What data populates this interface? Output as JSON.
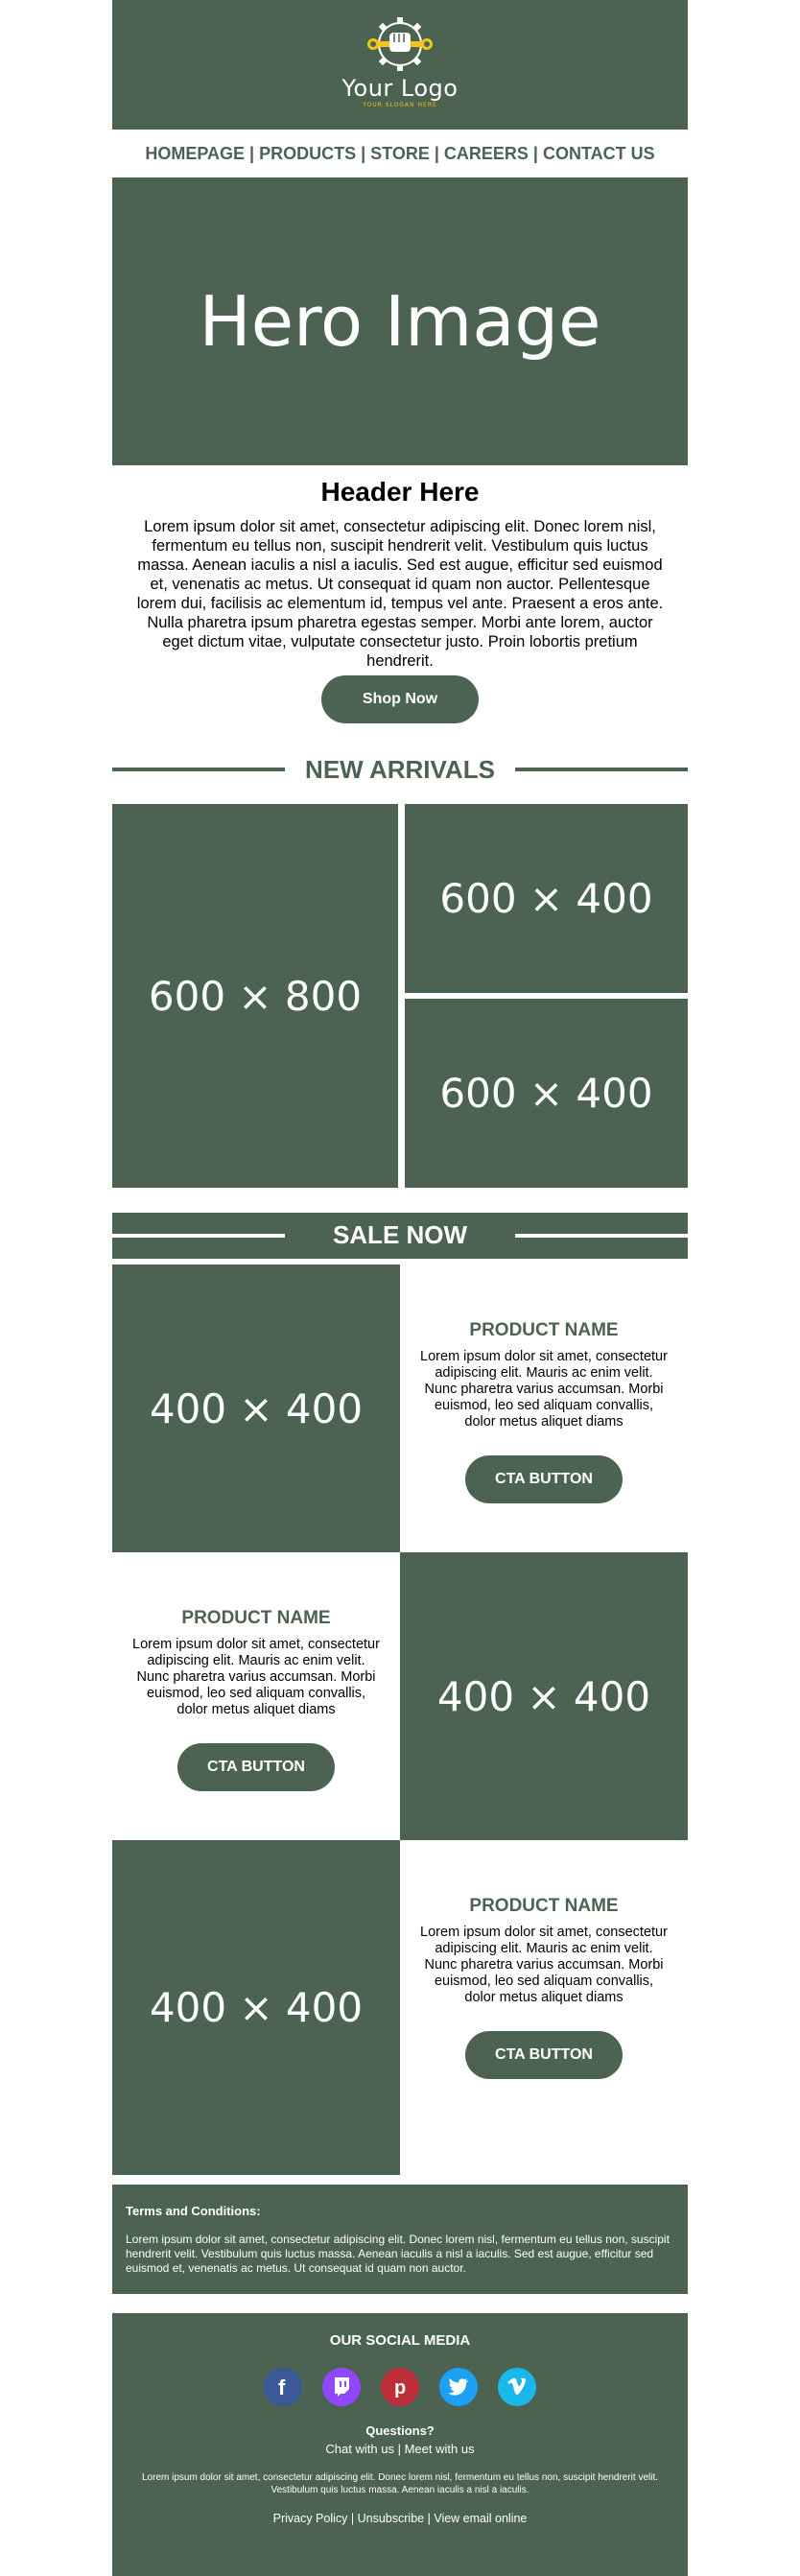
{
  "colors": {
    "brand": "#4b6350",
    "logo_accent": "#f0c419",
    "white": "#ffffff"
  },
  "logo": {
    "name": "Your Logo",
    "slogan": "YOUR SLOGAN HERE",
    "icon": "gear-wrench-fist-icon"
  },
  "nav": [
    {
      "label": "HOMEPAGE"
    },
    {
      "label": "PRODUCTS"
    },
    {
      "label": "STORE"
    },
    {
      "label": "CAREERS"
    },
    {
      "label": "CONTACT US"
    }
  ],
  "nav_separator": "|",
  "hero": {
    "text": "Hero Image"
  },
  "intro": {
    "title": "Header Here",
    "body": "Lorem ipsum dolor sit amet, consectetur adipiscing elit. Donec lorem nisl, fermentum eu tellus non, suscipit hendrerit velit. Vestibulum quis luctus massa. Aenean iaculis a nisl a iaculis. Sed est augue, efficitur sed euismod et, venenatis ac metus. Ut consequat id quam non auctor. Pellentesque lorem dui, facilisis ac elementum id, tempus vel ante. Praesent a eros ante. Nulla pharetra ipsum pharetra egestas semper. Morbi ante lorem, auctor eget dictum vitae, vulputate consectetur justo. Proin lobortis pretium hendrerit.",
    "button": "Shop Now"
  },
  "arrivals": {
    "title": "NEW ARRIVALS",
    "big": "600 × 800",
    "small_top": "600 × 400",
    "small_bottom": "600 × 400"
  },
  "sale": {
    "title": "SALE NOW",
    "products": [
      {
        "image": "400 × 400",
        "name": "PRODUCT NAME",
        "desc": "Lorem ipsum dolor sit amet, consectetur adipiscing elit. Mauris ac enim velit. Nunc pharetra varius accumsan. Morbi euismod, leo sed aliquam convallis, dolor metus aliquet diams",
        "button": "CTA BUTTON"
      },
      {
        "image": "400 × 400",
        "name": "PRODUCT NAME",
        "desc": "Lorem ipsum dolor sit amet, consectetur adipiscing elit. Mauris ac enim velit. Nunc pharetra varius accumsan. Morbi euismod, leo sed aliquam convallis, dolor metus aliquet diams",
        "button": "CTA BUTTON"
      },
      {
        "image": "400 × 400",
        "name": "PRODUCT NAME",
        "desc": "Lorem ipsum dolor sit amet, consectetur adipiscing elit. Mauris ac enim velit. Nunc pharetra varius accumsan. Morbi euismod, leo sed aliquam convallis, dolor metus aliquet diams",
        "button": "CTA BUTTON"
      }
    ]
  },
  "terms": {
    "title": "Terms and Conditions:",
    "body": "Lorem ipsum dolor sit amet, consectetur adipiscing elit. Donec lorem nisl, fermentum eu tellus non, suscipit hendrerit velit. Vestibulum quis luctus massa. Aenean iaculis a nisl a iaculis. Sed est augue, efficitur sed euismod et, venenatis ac metus. Ut consequat id quam non auctor."
  },
  "footer": {
    "social_title": "OUR SOCIAL MEDIA",
    "socials": [
      {
        "icon": "facebook-icon",
        "color": "#3b5998"
      },
      {
        "icon": "twitch-icon",
        "color": "#9146ff"
      },
      {
        "icon": "pinterest-icon",
        "color": "#bd2d3a"
      },
      {
        "icon": "twitter-icon",
        "color": "#1da1f2"
      },
      {
        "icon": "vimeo-icon",
        "color": "#1ab7ea"
      }
    ],
    "questions": "Questions?",
    "chat": "Chat with us",
    "meet": "Meet with us",
    "small": "Lorem ipsum dolor sit amet, consectetur adipiscing elit. Donec lorem nisl, fermentum eu tellus non, suscipit hendrerit velit. Vestibulum quis luctus massa. Aenean iaculis a nisl a iaculis.",
    "privacy": "Privacy Policy",
    "unsubscribe": "Unsubscribe",
    "view_online": "View email online"
  }
}
